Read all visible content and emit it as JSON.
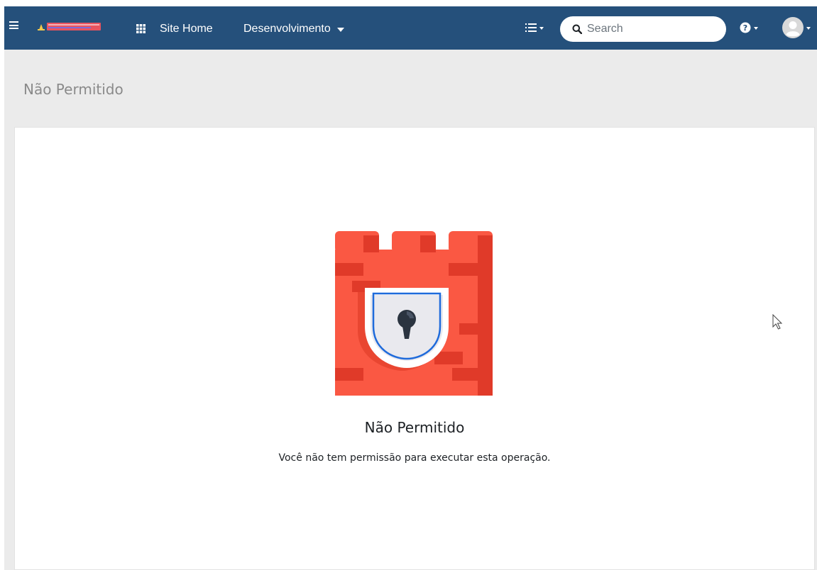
{
  "navbar": {
    "site_home_label": "Site Home",
    "development_menu_label": "Desenvolvimento",
    "search": {
      "placeholder": "Search",
      "value": ""
    }
  },
  "page": {
    "header_title": "Não Permitido"
  },
  "error": {
    "title": "Não Permitido",
    "message": "Você não tem permissão para executar esta operação."
  },
  "icons": {
    "menu": "hamburger-icon",
    "apps": "grid-icon",
    "list": "list-icon",
    "search": "search-icon",
    "help": "help-icon",
    "user": "avatar-icon",
    "illustration": "lock-castle-icon"
  },
  "colors": {
    "navbar": "#25507b",
    "page_background": "#ebebeb",
    "card_background": "#ffffff",
    "castle_red": "#fa5843",
    "castle_shadow": "#e03a29",
    "shield_accent": "#1f6bdb"
  }
}
